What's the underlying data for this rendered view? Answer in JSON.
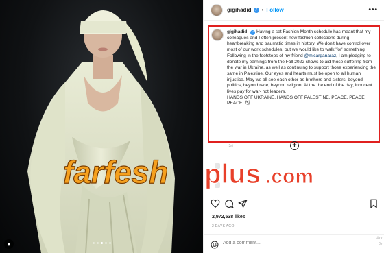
{
  "header": {
    "username": "gigihadid",
    "separator": "•",
    "follow_label": "Follow",
    "more_label": "•••"
  },
  "caption": {
    "username": "gigihadid",
    "text_part1": "Having a set Fashion Month schedule has meant that my colleagues and I often present new fashion collections during heartbreaking and traumatic times in history. We don't have control over most of our work schedules, but we would like to walk 'for' something. Following in the footsteps of my friend ",
    "mention": "@micarganaraz",
    "text_part2": ", I am pledging to donate my earnings from the Fall 2022 shows to aid those suffering from the war in Ukraine, as well as continuing to support those experiencing the same in Palestine. Our eyes and hearts must be open to all human injustice. May we all see each other as brothers and sisters, beyond politics, beyond race, beyond religion. At the the end of the day, innocent lives pay for war- not leaders.",
    "text_part3": "HANDS OFF UKRAINE. HANDS OFF PALESTINE. PEACE. PEACE. PEACE. 🕊",
    "time": "2d"
  },
  "watermark": {
    "part1": "farfesh",
    "part2": "plus",
    "part3": ".com"
  },
  "post": {
    "likes": "2,972,538 likes",
    "time_ago": "2 DAYS AGO",
    "comment_placeholder": "Add a comment...",
    "side_text_1": "Acc",
    "side_text_2": "Po"
  },
  "icons": {
    "verified": "verified-badge-icon",
    "like": "heart-icon",
    "comment": "comment-icon",
    "share": "share-icon",
    "save": "bookmark-icon",
    "add": "plus-circle-icon",
    "emoji": "emoji-icon",
    "user_tag": "user-tag-icon"
  },
  "colors": {
    "accent": "#0095f6",
    "highlight_border": "#e0201f",
    "watermark_orange": "#f5a01e",
    "watermark_red": "#e8402a"
  }
}
